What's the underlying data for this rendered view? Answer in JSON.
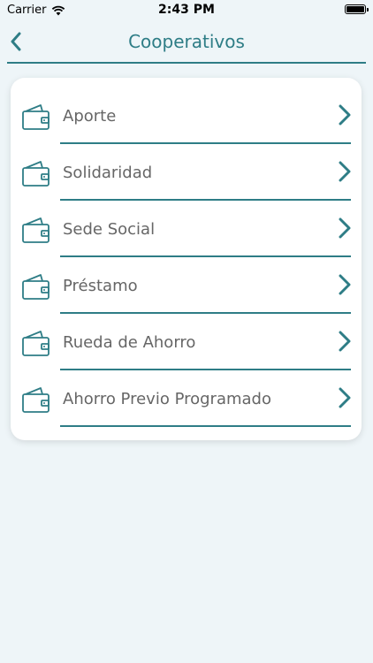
{
  "status_bar": {
    "carrier": "Carrier",
    "time": "2:43 PM"
  },
  "nav": {
    "title": "Cooperativos"
  },
  "colors": {
    "accent": "#2e7d86",
    "background": "#eef5f8",
    "label": "#666666"
  },
  "menu": {
    "items": [
      {
        "label": "Aporte",
        "icon": "wallet-icon"
      },
      {
        "label": "Solidaridad",
        "icon": "wallet-icon"
      },
      {
        "label": "Sede Social",
        "icon": "wallet-icon"
      },
      {
        "label": "Préstamo",
        "icon": "wallet-icon"
      },
      {
        "label": "Rueda de Ahorro",
        "icon": "wallet-icon"
      },
      {
        "label": "Ahorro Previo Programado",
        "icon": "wallet-icon"
      }
    ]
  }
}
